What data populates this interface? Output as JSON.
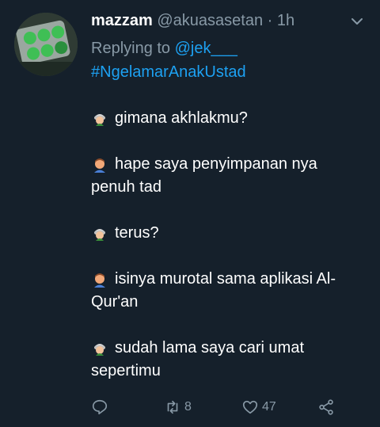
{
  "tweet": {
    "name": "mazzam",
    "handle": "@akuasasetan",
    "separator": "·",
    "time": "1h",
    "reply_prefix": "Replying to",
    "reply_to": "@jek___",
    "hashtag": "#NgelamarAnakUstad",
    "lines": [
      "gimana akhlakmu?",
      "hape saya penyimpanan nya",
      "penuh tad",
      "terus?",
      "isinya murotal sama aplikasi Al-",
      "Qur'an",
      "sudah lama saya cari umat",
      "sepertimu"
    ],
    "actions": {
      "retweets": "8",
      "likes": "47"
    },
    "icons": [
      "chevron-down-icon",
      "reply-icon",
      "retweet-icon",
      "like-icon",
      "share-icon",
      "man-with-turban-icon",
      "boy-emoji-icon"
    ],
    "colors": {
      "background": "#15202b",
      "link": "#1da1f2",
      "muted": "#8899a6"
    }
  }
}
